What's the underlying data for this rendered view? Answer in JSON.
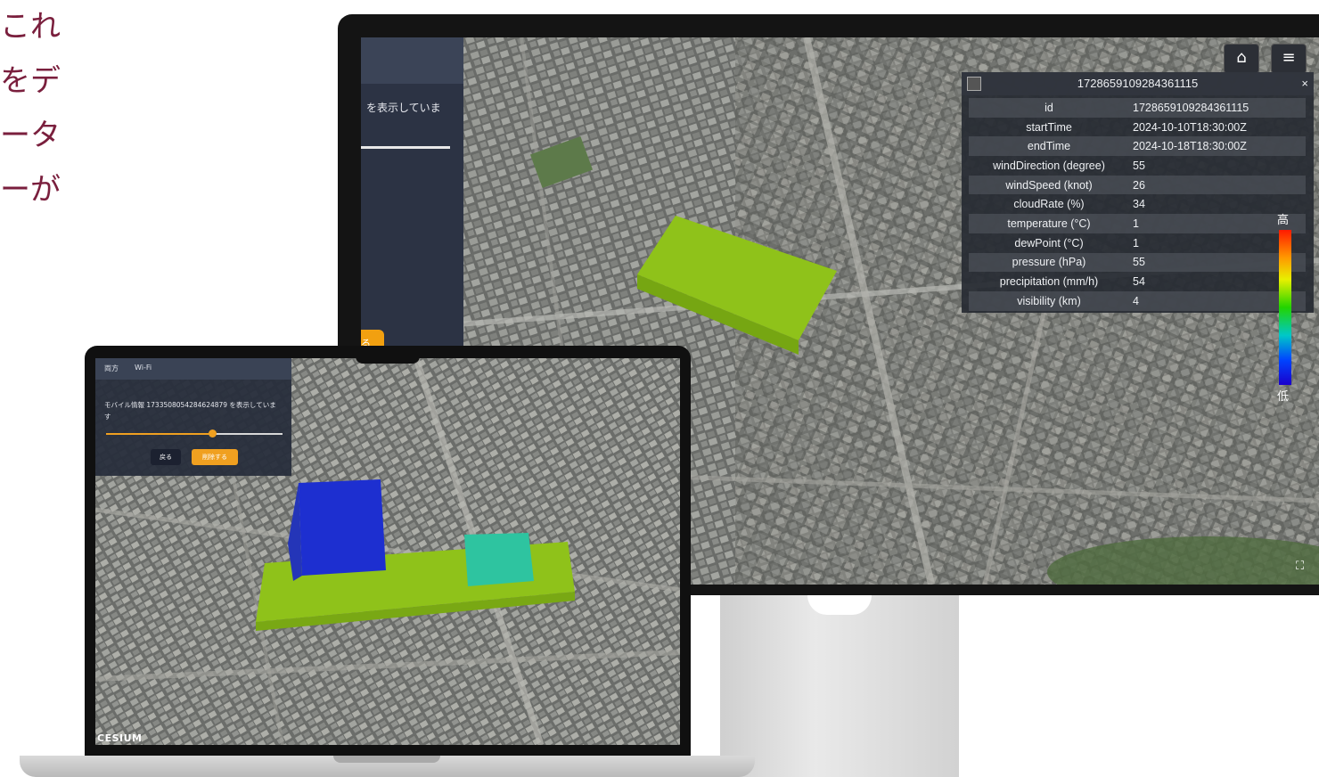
{
  "side_text": [
    "これ",
    "をデ",
    "ータ",
    "ーが"
  ],
  "monitor": {
    "panel": {
      "message": "を表示していま",
      "button_label": "る"
    },
    "buttons": {
      "home_icon": "home-icon",
      "menu_icon": "menu-icon"
    },
    "infobox": {
      "title": "1728659109284361115",
      "close_label": "×",
      "rows": [
        {
          "key": "id",
          "value": "1728659109284361115"
        },
        {
          "key": "startTime",
          "value": "2024-10-10T18:30:00Z"
        },
        {
          "key": "endTime",
          "value": "2024-10-18T18:30:00Z"
        },
        {
          "key": "windDirection (degree)",
          "value": "55"
        },
        {
          "key": "windSpeed (knot)",
          "value": "26"
        },
        {
          "key": "cloudRate (%)",
          "value": "34"
        },
        {
          "key": "temperature (°C)",
          "value": "1"
        },
        {
          "key": "dewPoint (°C)",
          "value": "1"
        },
        {
          "key": "pressure (hPa)",
          "value": "55"
        },
        {
          "key": "precipitation (mm/h)",
          "value": "54"
        },
        {
          "key": "visibility (km)",
          "value": "4"
        }
      ]
    },
    "legend": {
      "high": "高",
      "low": "低"
    }
  },
  "laptop": {
    "panel": {
      "tabs": [
        "両方",
        "Wi-Fi"
      ],
      "message": "モバイル情報 1733508054284624879 を表示しています",
      "slider_value": 0.6,
      "back_label": "戻る",
      "delete_label": "削除する"
    },
    "brand": "CESIUM"
  },
  "colors": {
    "accent_orange": "#f0a020",
    "voxel_green": "#8fc21a",
    "voxel_blue": "#1d2fd0",
    "voxel_teal": "#2ec4a0",
    "side_text": "#7a1f3d"
  }
}
